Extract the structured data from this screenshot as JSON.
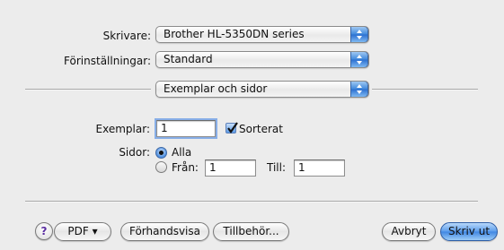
{
  "printer": {
    "label": "Skrivare:",
    "value": "Brother HL-5350DN series"
  },
  "presets": {
    "label": "Förinställningar:",
    "value": "Standard"
  },
  "panel": {
    "value": "Exemplar och sidor"
  },
  "copies": {
    "label": "Exemplar:",
    "value": "1",
    "collate_label": "Sorterat",
    "collate_checked": true
  },
  "pages": {
    "label": "Sidor:",
    "all_label": "Alla",
    "from_label": "Från:",
    "from_value": "1",
    "to_label": "Till:",
    "to_value": "1",
    "selected": "all"
  },
  "footer": {
    "help_label": "?",
    "pdf_label": "PDF ▾",
    "preview_label": "Förhandsvisa",
    "supplies_label": "Tillbehör...",
    "cancel_label": "Avbryt",
    "print_label": "Skriv ut"
  }
}
